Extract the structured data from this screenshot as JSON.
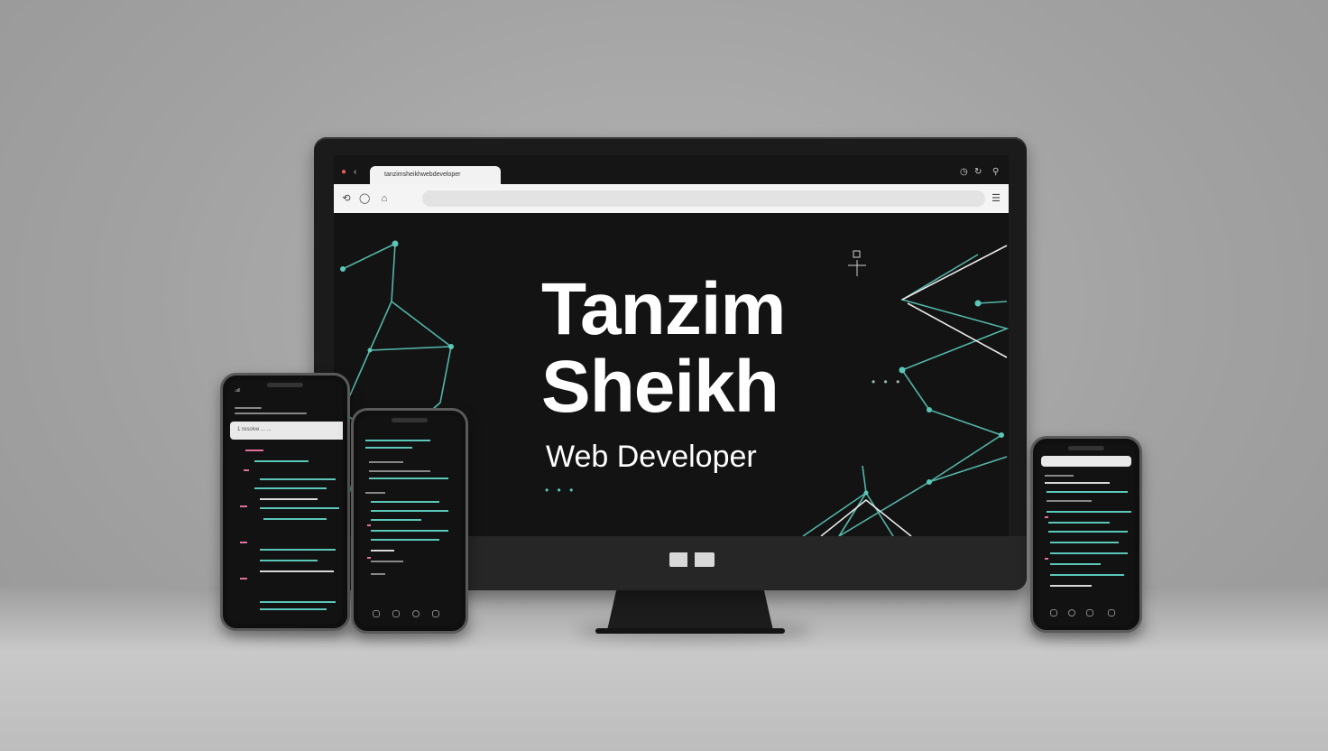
{
  "monitor": {
    "tab_title": "tanzimsheikhwebdeveloper",
    "url_placeholder": "",
    "hero": {
      "name_line1": "Tanzim",
      "name_line2": "Sheikh",
      "role": "Web Developer"
    },
    "accent_color": "#5bc7b8"
  },
  "phone_left": {
    "status": ".ull",
    "search_text": "1 resolve ... ..."
  },
  "phone_middle": {},
  "phone_right": {}
}
